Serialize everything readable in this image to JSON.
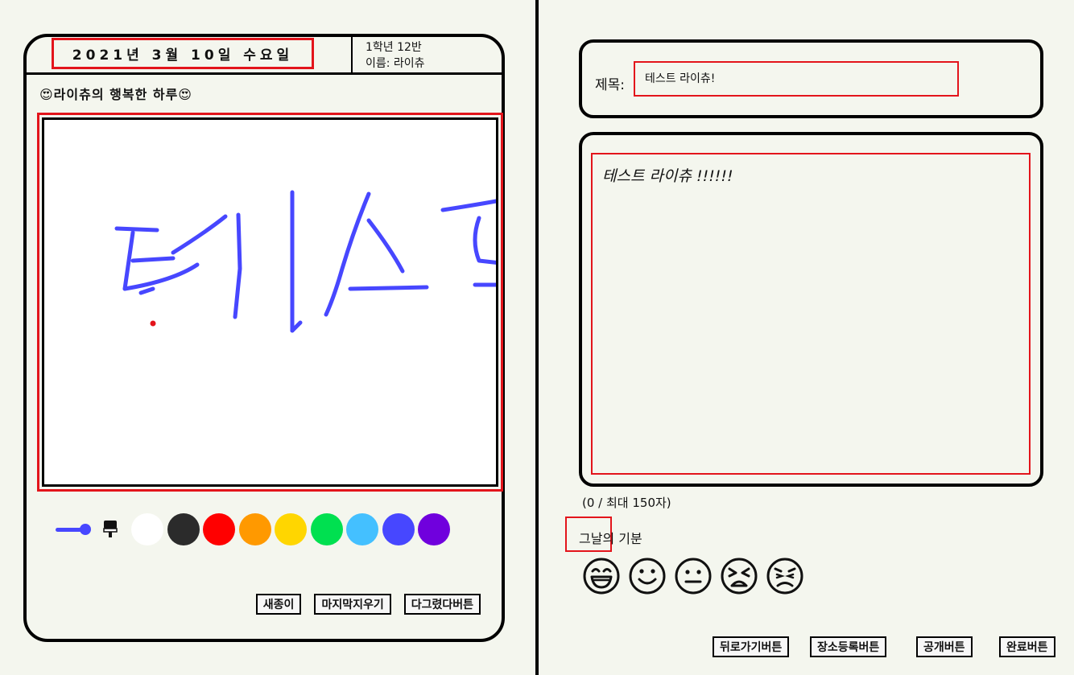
{
  "diary": {
    "date": "2021년 3월 10일 수요일",
    "class_line": "1학년 12반",
    "name_line": "이름: 라이츄",
    "title": "😍라이츄의 행복한 하루😍"
  },
  "palette": {
    "pen_color": "#4747ff",
    "colors": [
      "#ffffff",
      "#2b2b2b",
      "#ff0000",
      "#ff9900",
      "#ffd600",
      "#00e050",
      "#44c0ff",
      "#4747ff",
      "#7000dd"
    ]
  },
  "canvas": {
    "drawing_text": "테스트",
    "stroke_color": "#4747ff"
  },
  "drawing_buttons": {
    "new_paper": "새종이",
    "undo_last": "마지막지우기",
    "done_drawing": "다그렸다버튼"
  },
  "form": {
    "title_label": "제목:",
    "title_value": "테스트 라이츄!",
    "content_value": "테스트 라이츄 !!!!!!",
    "char_count": "(0 / 최대 150자)",
    "mood_label": "그날의 기분"
  },
  "moods": [
    "grinning-face",
    "smiling-face",
    "neutral-face",
    "angry-face",
    "sad-face"
  ],
  "actions": {
    "back": "뒤로가기버튼",
    "place": "장소등록버튼",
    "public": "공개버튼",
    "done": "완료버튼"
  }
}
